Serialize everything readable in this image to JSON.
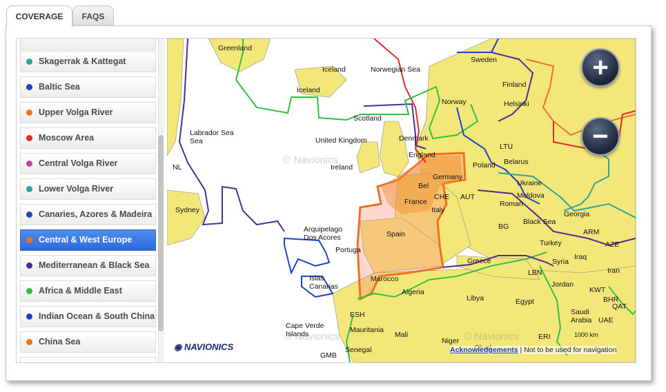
{
  "tabs": [
    {
      "label": "COVERAGE",
      "active": true
    },
    {
      "label": "FAQS",
      "active": false
    }
  ],
  "regions": [
    {
      "label": "Skagerrak & Kattegat",
      "color": "#2aa39a"
    },
    {
      "label": "Baltic Sea",
      "color": "#2040c8"
    },
    {
      "label": "Upper Volga River",
      "color": "#f07020"
    },
    {
      "label": "Moscow Area",
      "color": "#e02828"
    },
    {
      "label": "Central Volga River",
      "color": "#c83cb0"
    },
    {
      "label": "Lower Volga River",
      "color": "#2aa39a"
    },
    {
      "label": "Canaries, Azores & Madeira",
      "color": "#2040c8"
    },
    {
      "label": "Central & West Europe",
      "color": "#f07020",
      "selected": true
    },
    {
      "label": "Mediterranean & Black Sea",
      "color": "#4a2c90"
    },
    {
      "label": "Africa & Middle East",
      "color": "#30c040"
    },
    {
      "label": "Indian Ocean & South China...",
      "color": "#2040c8"
    },
    {
      "label": "China Sea",
      "color": "#f07020"
    }
  ],
  "map": {
    "labels": [
      {
        "text": "Greenland"
      },
      {
        "text": "Iceland"
      },
      {
        "text": "Iceland"
      },
      {
        "text": "Norwegian Sea"
      },
      {
        "text": "Labrador Sea"
      },
      {
        "text": "Sea"
      },
      {
        "text": "NL"
      },
      {
        "text": "Sydney"
      },
      {
        "text": "United Kingdom"
      },
      {
        "text": "Scotland"
      },
      {
        "text": "Ireland"
      },
      {
        "text": "Denmark"
      },
      {
        "text": "England"
      },
      {
        "text": "Norway"
      },
      {
        "text": "Sweden"
      },
      {
        "text": "Finland"
      },
      {
        "text": "Helsinki"
      },
      {
        "text": "LTU"
      },
      {
        "text": "Belarus"
      },
      {
        "text": "Poland"
      },
      {
        "text": "Germany"
      },
      {
        "text": "Bel"
      },
      {
        "text": "France"
      },
      {
        "text": "CHE"
      },
      {
        "text": "AUT"
      },
      {
        "text": "Ukraine"
      },
      {
        "text": "Moldova"
      },
      {
        "text": "Roman"
      },
      {
        "text": "Black Sea"
      },
      {
        "text": "Georgia"
      },
      {
        "text": "ARM"
      },
      {
        "text": "AZE"
      },
      {
        "text": "Turkey"
      },
      {
        "text": "Spain"
      },
      {
        "text": "Portuga"
      },
      {
        "text": "Arquipelago"
      },
      {
        "text": "Dos Acores"
      },
      {
        "text": "Islas"
      },
      {
        "text": "Canarias"
      },
      {
        "text": "Marocco"
      },
      {
        "text": "Algeria"
      },
      {
        "text": "Libya"
      },
      {
        "text": "Egypt"
      },
      {
        "text": "Syria"
      },
      {
        "text": "Iraq"
      },
      {
        "text": "Iran"
      },
      {
        "text": "Jordan"
      },
      {
        "text": "LBN"
      },
      {
        "text": "Greece"
      },
      {
        "text": "Mauritania"
      },
      {
        "text": "Mali"
      },
      {
        "text": "Niger"
      },
      {
        "text": "Chad"
      },
      {
        "text": "Senegal"
      },
      {
        "text": "GMB"
      },
      {
        "text": "Cape Verde"
      },
      {
        "text": "Islands"
      },
      {
        "text": "ESH"
      },
      {
        "text": "ERI"
      },
      {
        "text": "Saudi"
      },
      {
        "text": "Arabia"
      },
      {
        "text": "UAE"
      },
      {
        "text": "QAT"
      },
      {
        "text": "BHR"
      },
      {
        "text": "KWT"
      },
      {
        "text": "Italy"
      },
      {
        "text": "BG"
      }
    ],
    "zoom_in_label": "+",
    "zoom_out_label": "−",
    "watermark": "© Navionics",
    "logo_text": "NAVIONICS",
    "scale_label": "1000 km",
    "attribution_link": "Acknowledgements",
    "attribution_text": "| Not to be used for navigation"
  }
}
